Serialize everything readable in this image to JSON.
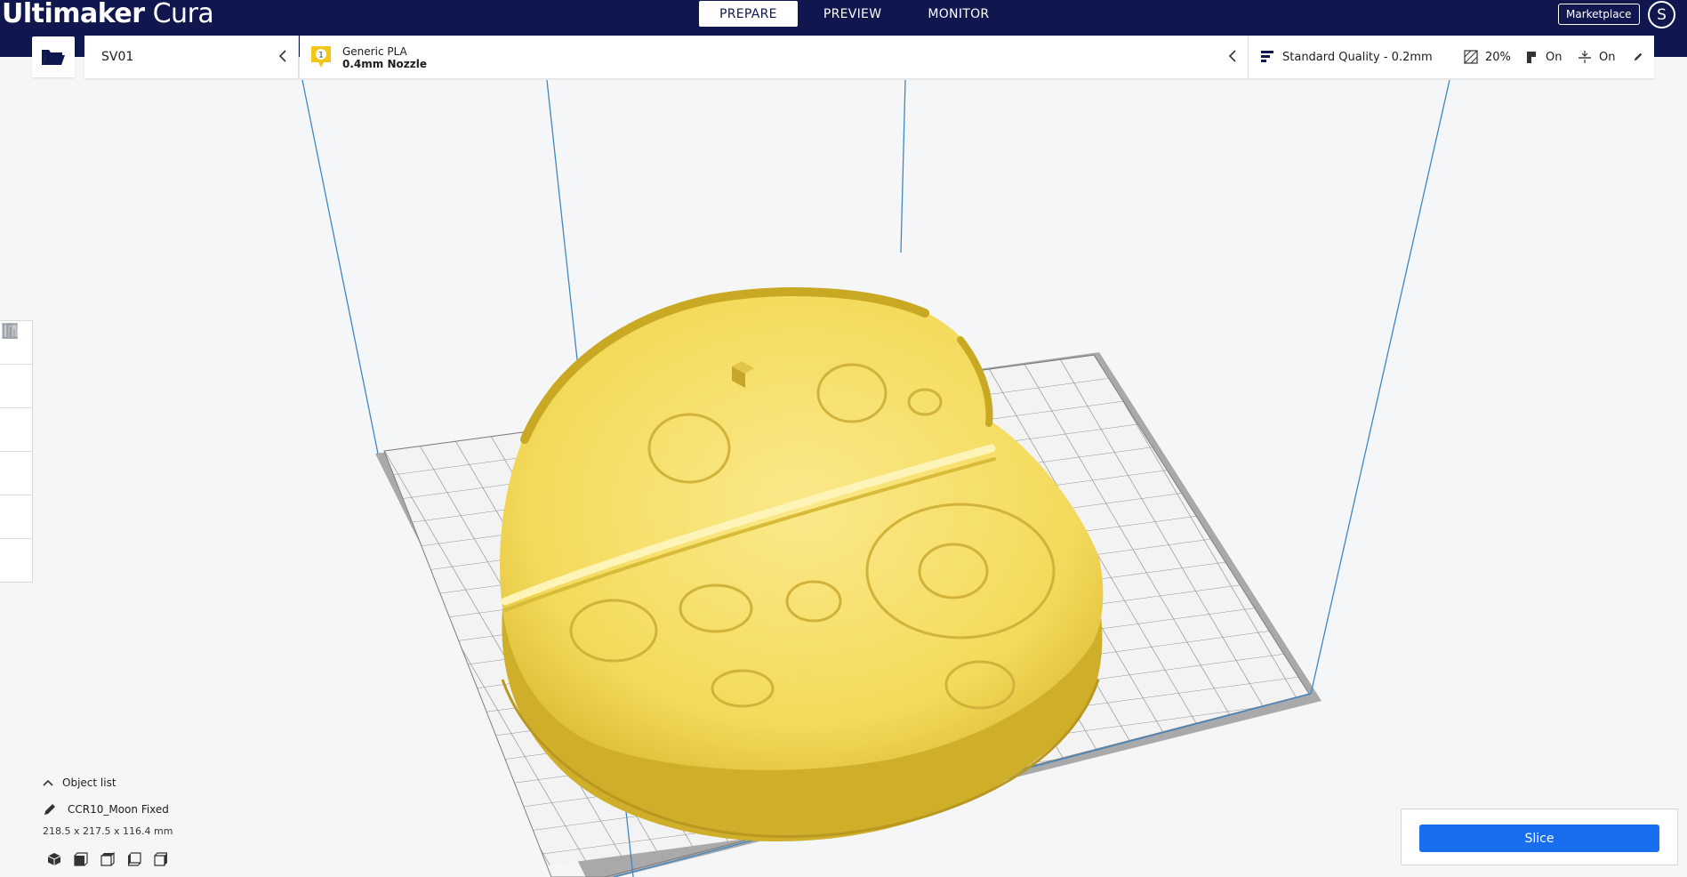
{
  "app": {
    "brand": "Ultimaker",
    "product": "Cura"
  },
  "main_tabs": [
    {
      "label": "PREPARE",
      "active": true
    },
    {
      "label": "PREVIEW",
      "active": false
    },
    {
      "label": "MONITOR",
      "active": false
    }
  ],
  "header": {
    "marketplace_label": "Marketplace",
    "account_initial": "S"
  },
  "toolbar": {
    "open_file_icon": "folder-open-icon",
    "printer_name": "SV01",
    "material": {
      "extruder_number": "1",
      "name": "Generic PLA",
      "nozzle": "0.4mm Nozzle",
      "badge_color": "#f5c518"
    },
    "print_settings": {
      "quality": "Standard Quality - 0.2mm",
      "infill": "20%",
      "support": "On",
      "adhesion": "On"
    }
  },
  "tools": [
    {
      "name": "move-tool",
      "icon": "move-icon"
    },
    {
      "name": "scale-tool",
      "icon": "scale-icon"
    },
    {
      "name": "rotate-tool",
      "icon": "rotate-icon"
    },
    {
      "name": "mirror-tool",
      "icon": "mirror-icon"
    },
    {
      "name": "per-model-settings-tool",
      "icon": "per-model-settings-icon"
    },
    {
      "name": "support-blocker-tool",
      "icon": "support-blocker-icon"
    }
  ],
  "object_list": {
    "toggle_label": "Object list",
    "object_name": "CCR10_Moon Fixed",
    "dimensions": "218.5 x 217.5 x 116.4 mm"
  },
  "view_buttons": [
    "3d-view-icon",
    "front-view-icon",
    "top-view-icon",
    "left-view-icon",
    "right-view-icon"
  ],
  "slice_label": "Slice",
  "colors": {
    "header_bg": "#10174e",
    "accent_blue": "#196ef0",
    "model_yellow": "#f6df6b",
    "build_volume_line": "#3f88c5"
  }
}
